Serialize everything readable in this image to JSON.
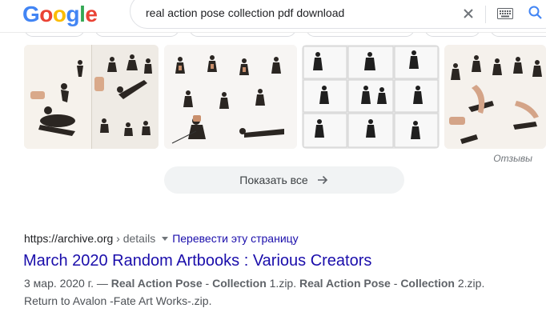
{
  "logo": [
    "G",
    "o",
    "o",
    "g",
    "l",
    "e"
  ],
  "search": {
    "query": "real action pose collection pdf download"
  },
  "images": {
    "source_label": "Отзывы",
    "show_all_label": "Показать все"
  },
  "result": {
    "domain": "https://archive.org",
    "path": " › details",
    "translate_label": "Перевести эту страницу",
    "title": "March 2020 Random Artbooks : Various Creators",
    "date": "3 мар. 2020 г.",
    "dash": " — ",
    "snip_1": "Real Action Pose",
    "snip_2": " - ",
    "snip_3": "Collection",
    "snip_4": " 1.zip. ",
    "snip_5": "Real Action Pose",
    "snip_6": " - ",
    "snip_7": "Collection",
    "snip_8": " 2.zip.",
    "snip_line2": "Return to Avalon -Fate Art Works-.zip."
  }
}
